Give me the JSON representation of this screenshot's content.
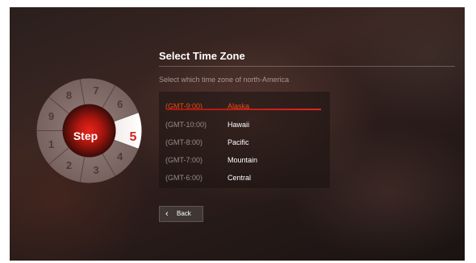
{
  "wheel": {
    "label": "Step",
    "active_step": "5",
    "steps": [
      "1",
      "2",
      "3",
      "4",
      "6",
      "7",
      "8",
      "9"
    ],
    "accent": "#d9221b"
  },
  "panel": {
    "title": "Select Time Zone",
    "subtitle": "Select which time zone of north-America",
    "zones": [
      {
        "gmt": "(GMT-9:00)",
        "name": "Alaska",
        "selected": true
      },
      {
        "gmt": "(GMT-10:00)",
        "name": "Hawaii",
        "selected": false
      },
      {
        "gmt": "(GMT-8:00)",
        "name": "Pacific",
        "selected": false
      },
      {
        "gmt": "(GMT-7:00)",
        "name": "Mountain",
        "selected": false
      },
      {
        "gmt": "(GMT-6:00)",
        "name": "Central",
        "selected": false
      }
    ],
    "selected_color": "#e94b15"
  },
  "back_button": {
    "label": "Back",
    "icon": "chevron-left-icon"
  }
}
